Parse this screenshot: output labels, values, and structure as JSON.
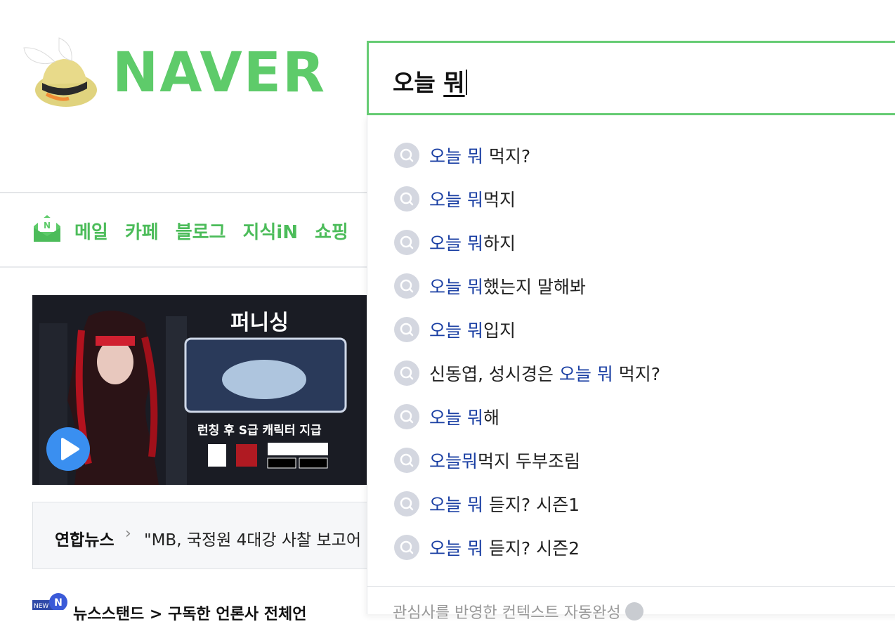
{
  "brand": {
    "logo_text": "NAVER",
    "accent": "#5ecb6a"
  },
  "search": {
    "typed": "오늘 ",
    "composing": "뭐"
  },
  "nav": {
    "items": [
      {
        "label": "메일"
      },
      {
        "label": "카페"
      },
      {
        "label": "블로그"
      },
      {
        "label": "지식iN"
      },
      {
        "label": "쇼핑"
      }
    ]
  },
  "banner": {
    "title": "퍼니싱",
    "subtitle": "런칭 후 S급 캐릭터 지급"
  },
  "news": {
    "source": "연합뉴스",
    "headline": "\"MB, 국정원 4대강 사찰 보고어"
  },
  "bottom": {
    "text": "뉴스스탠드 >    구독한 언론사    전체언"
  },
  "autocomplete": {
    "highlight_color": "#1a3fa3",
    "suggestions": [
      {
        "pre": "",
        "hl": "오늘 뭐",
        "post": " 먹지?"
      },
      {
        "pre": "",
        "hl": "오늘 뭐",
        "post": "먹지"
      },
      {
        "pre": "",
        "hl": "오늘 뭐",
        "post": "하지"
      },
      {
        "pre": "",
        "hl": "오늘 뭐",
        "post": "했는지 말해봐"
      },
      {
        "pre": "",
        "hl": "오늘 뭐",
        "post": "입지"
      },
      {
        "pre": "신동엽, 성시경은 ",
        "hl": "오늘 뭐",
        "post": " 먹지?"
      },
      {
        "pre": "",
        "hl": "오늘 뭐",
        "post": "해"
      },
      {
        "pre": "",
        "hl": "오늘뭐",
        "post": "먹지 두부조림"
      },
      {
        "pre": "",
        "hl": "오늘 뭐",
        "post": " 듣지? 시즌1"
      },
      {
        "pre": "",
        "hl": "오늘 뭐",
        "post": " 듣지? 시즌2"
      }
    ],
    "footer": "관심사를 반영한 컨텍스트 자동완성"
  }
}
